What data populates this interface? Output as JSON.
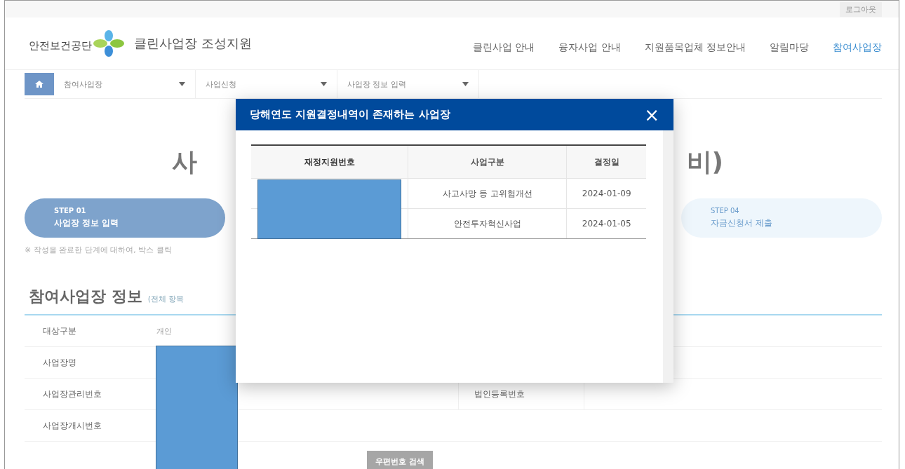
{
  "top_bar": {
    "logout_button": "로그아웃"
  },
  "header": {
    "org_name": "안전보건공단",
    "site_title": "클린사업장 조성지원",
    "nav": [
      {
        "label": "클린사업 안내",
        "selected": false
      },
      {
        "label": "융자사업 안내",
        "selected": false
      },
      {
        "label": "지원품목업체 정보안내",
        "selected": false
      },
      {
        "label": "알림마당",
        "selected": false
      },
      {
        "label": "참여사업장",
        "selected": true
      }
    ]
  },
  "breadcrumb": [
    "참여사업장",
    "사업신청",
    "사업장 정보 입력"
  ],
  "page_title": {
    "left": "사",
    "right": "비)"
  },
  "steps": [
    {
      "number": "STEP 01",
      "label": "사업장 정보 입력",
      "selected": true
    },
    {
      "number": "STEP 04",
      "label": "자금신청서 제출",
      "selected": false
    }
  ],
  "note": "※ 작성을 완료한 단계에 대하여, 박스 클릭",
  "section": {
    "title": "참여사업장 정보",
    "hint": "(전체 항목"
  },
  "form": {
    "rows": [
      {
        "label": "대상구분",
        "value": "개인"
      },
      {
        "label": "사업장명"
      },
      {
        "label": "사업장관리번호",
        "label_2": "법인등록번호"
      },
      {
        "label": "사업장개시번호"
      }
    ],
    "zip_button": "우편번호 검색"
  },
  "modal": {
    "title": "당해연도 지원결정내역이 존재하는 사업장",
    "close": "×",
    "table": {
      "columns": [
        "재정지원번호",
        "사업구분",
        "결정일"
      ],
      "rows": [
        {
          "type": "사고사망 등 고위험개선",
          "date": "2024-01-09"
        },
        {
          "type": "안전투자혁신사업",
          "date": "2024-01-05"
        }
      ]
    }
  }
}
